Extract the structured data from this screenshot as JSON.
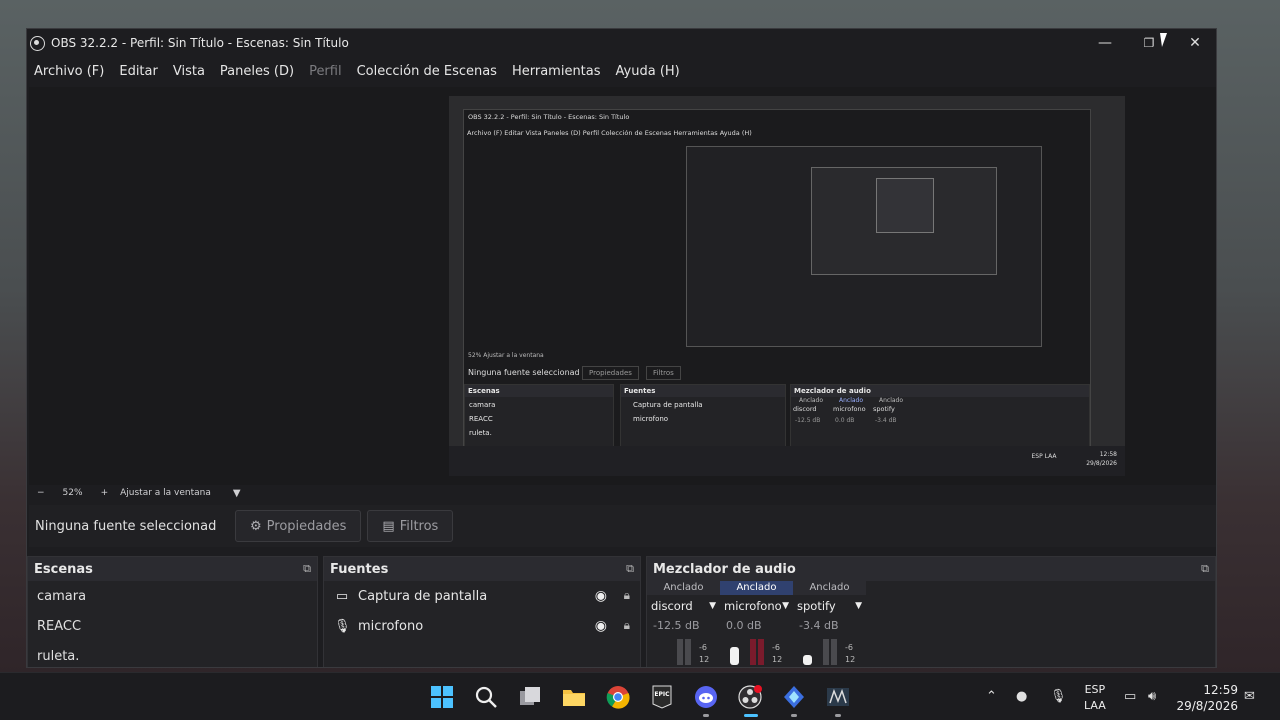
{
  "window": {
    "title": "OBS 32.2.2 - Perfil: Sin Título - Escenas: Sin Título",
    "controls": {
      "minimize": "—",
      "restore": "❐",
      "close": "✕"
    }
  },
  "menu": [
    {
      "label": "Archivo (F)",
      "enabled": true
    },
    {
      "label": "Editar",
      "enabled": true
    },
    {
      "label": "Vista",
      "enabled": true
    },
    {
      "label": "Paneles (D)",
      "enabled": true
    },
    {
      "label": "Perfil",
      "enabled": false
    },
    {
      "label": "Colección de Escenas",
      "enabled": true
    },
    {
      "label": "Herramientas",
      "enabled": true
    },
    {
      "label": "Ayuda (H)",
      "enabled": true
    }
  ],
  "zoom": {
    "minus": "−",
    "value": "52%",
    "plus": "+",
    "fit": "Ajustar a la ventana"
  },
  "source_bar": {
    "no_source": "Ninguna fuente seleccionad",
    "properties": "Propiedades",
    "filters": "Filtros"
  },
  "scenes": {
    "title": "Escenas",
    "items": [
      "camara",
      "REACC",
      "ruleta."
    ]
  },
  "sources": {
    "title": "Fuentes",
    "items": [
      {
        "label": "Captura de pantalla",
        "icon": "monitor-icon"
      },
      {
        "label": "microfono",
        "icon": "microphone-icon"
      }
    ]
  },
  "mixer": {
    "title": "Mezclador de audio",
    "channels": [
      {
        "anchor": "Anclado",
        "active": false,
        "name": "discord",
        "db": "-12.5 dB"
      },
      {
        "anchor": "Anclado",
        "active": true,
        "name": "microfono",
        "db": "0.0 dB"
      },
      {
        "anchor": "Anclado",
        "active": false,
        "name": "spotify",
        "db": "-3.4 dB"
      }
    ],
    "scale": [
      "-6",
      "12"
    ]
  },
  "preview": {
    "inner_title": "OBS 32.2.2 - Perfil: Sin Título - Escenas: Sin Título",
    "inner_menu": "Archivo (F)   Editar   Vista   Paneles (D)   Perfil   Colección de Escenas   Herramientas   Ayuda (H)",
    "inner_zoom": "52%   Ajustar a la ventana",
    "inner_no_source": "Ninguna fuente seleccionad",
    "inner_properties": "Propiedades",
    "inner_filters": "Filtros",
    "inner_scenes": "Escenas",
    "inner_sources": "Fuentes",
    "inner_mixer": "Mezclador de audio",
    "inner_scene_items": [
      "camara",
      "REACC",
      "ruleta."
    ],
    "inner_source_items": [
      "Captura de pantalla",
      "microfono"
    ],
    "inner_mixer_names": [
      "discord",
      "microfono",
      "spotify"
    ],
    "inner_anchor": "Anclado",
    "inner_dbs": [
      "-12.5 dB",
      "0.0 dB",
      "-3.4 dB"
    ],
    "inner_lang": "ESP LAA",
    "inner_time": "12:58",
    "inner_date": "29/8/2026"
  },
  "taskbar": {
    "apps": [
      "windows-start-icon",
      "search-icon",
      "task-view-icon",
      "file-explorer-icon",
      "chrome-icon",
      "epic-games-icon",
      "discord-icon",
      "obs-icon",
      "app-icon",
      "game-icon"
    ],
    "lang_top": "ESP",
    "lang_bottom": "LAA",
    "time": "12:59",
    "date": "29/8/2026"
  }
}
